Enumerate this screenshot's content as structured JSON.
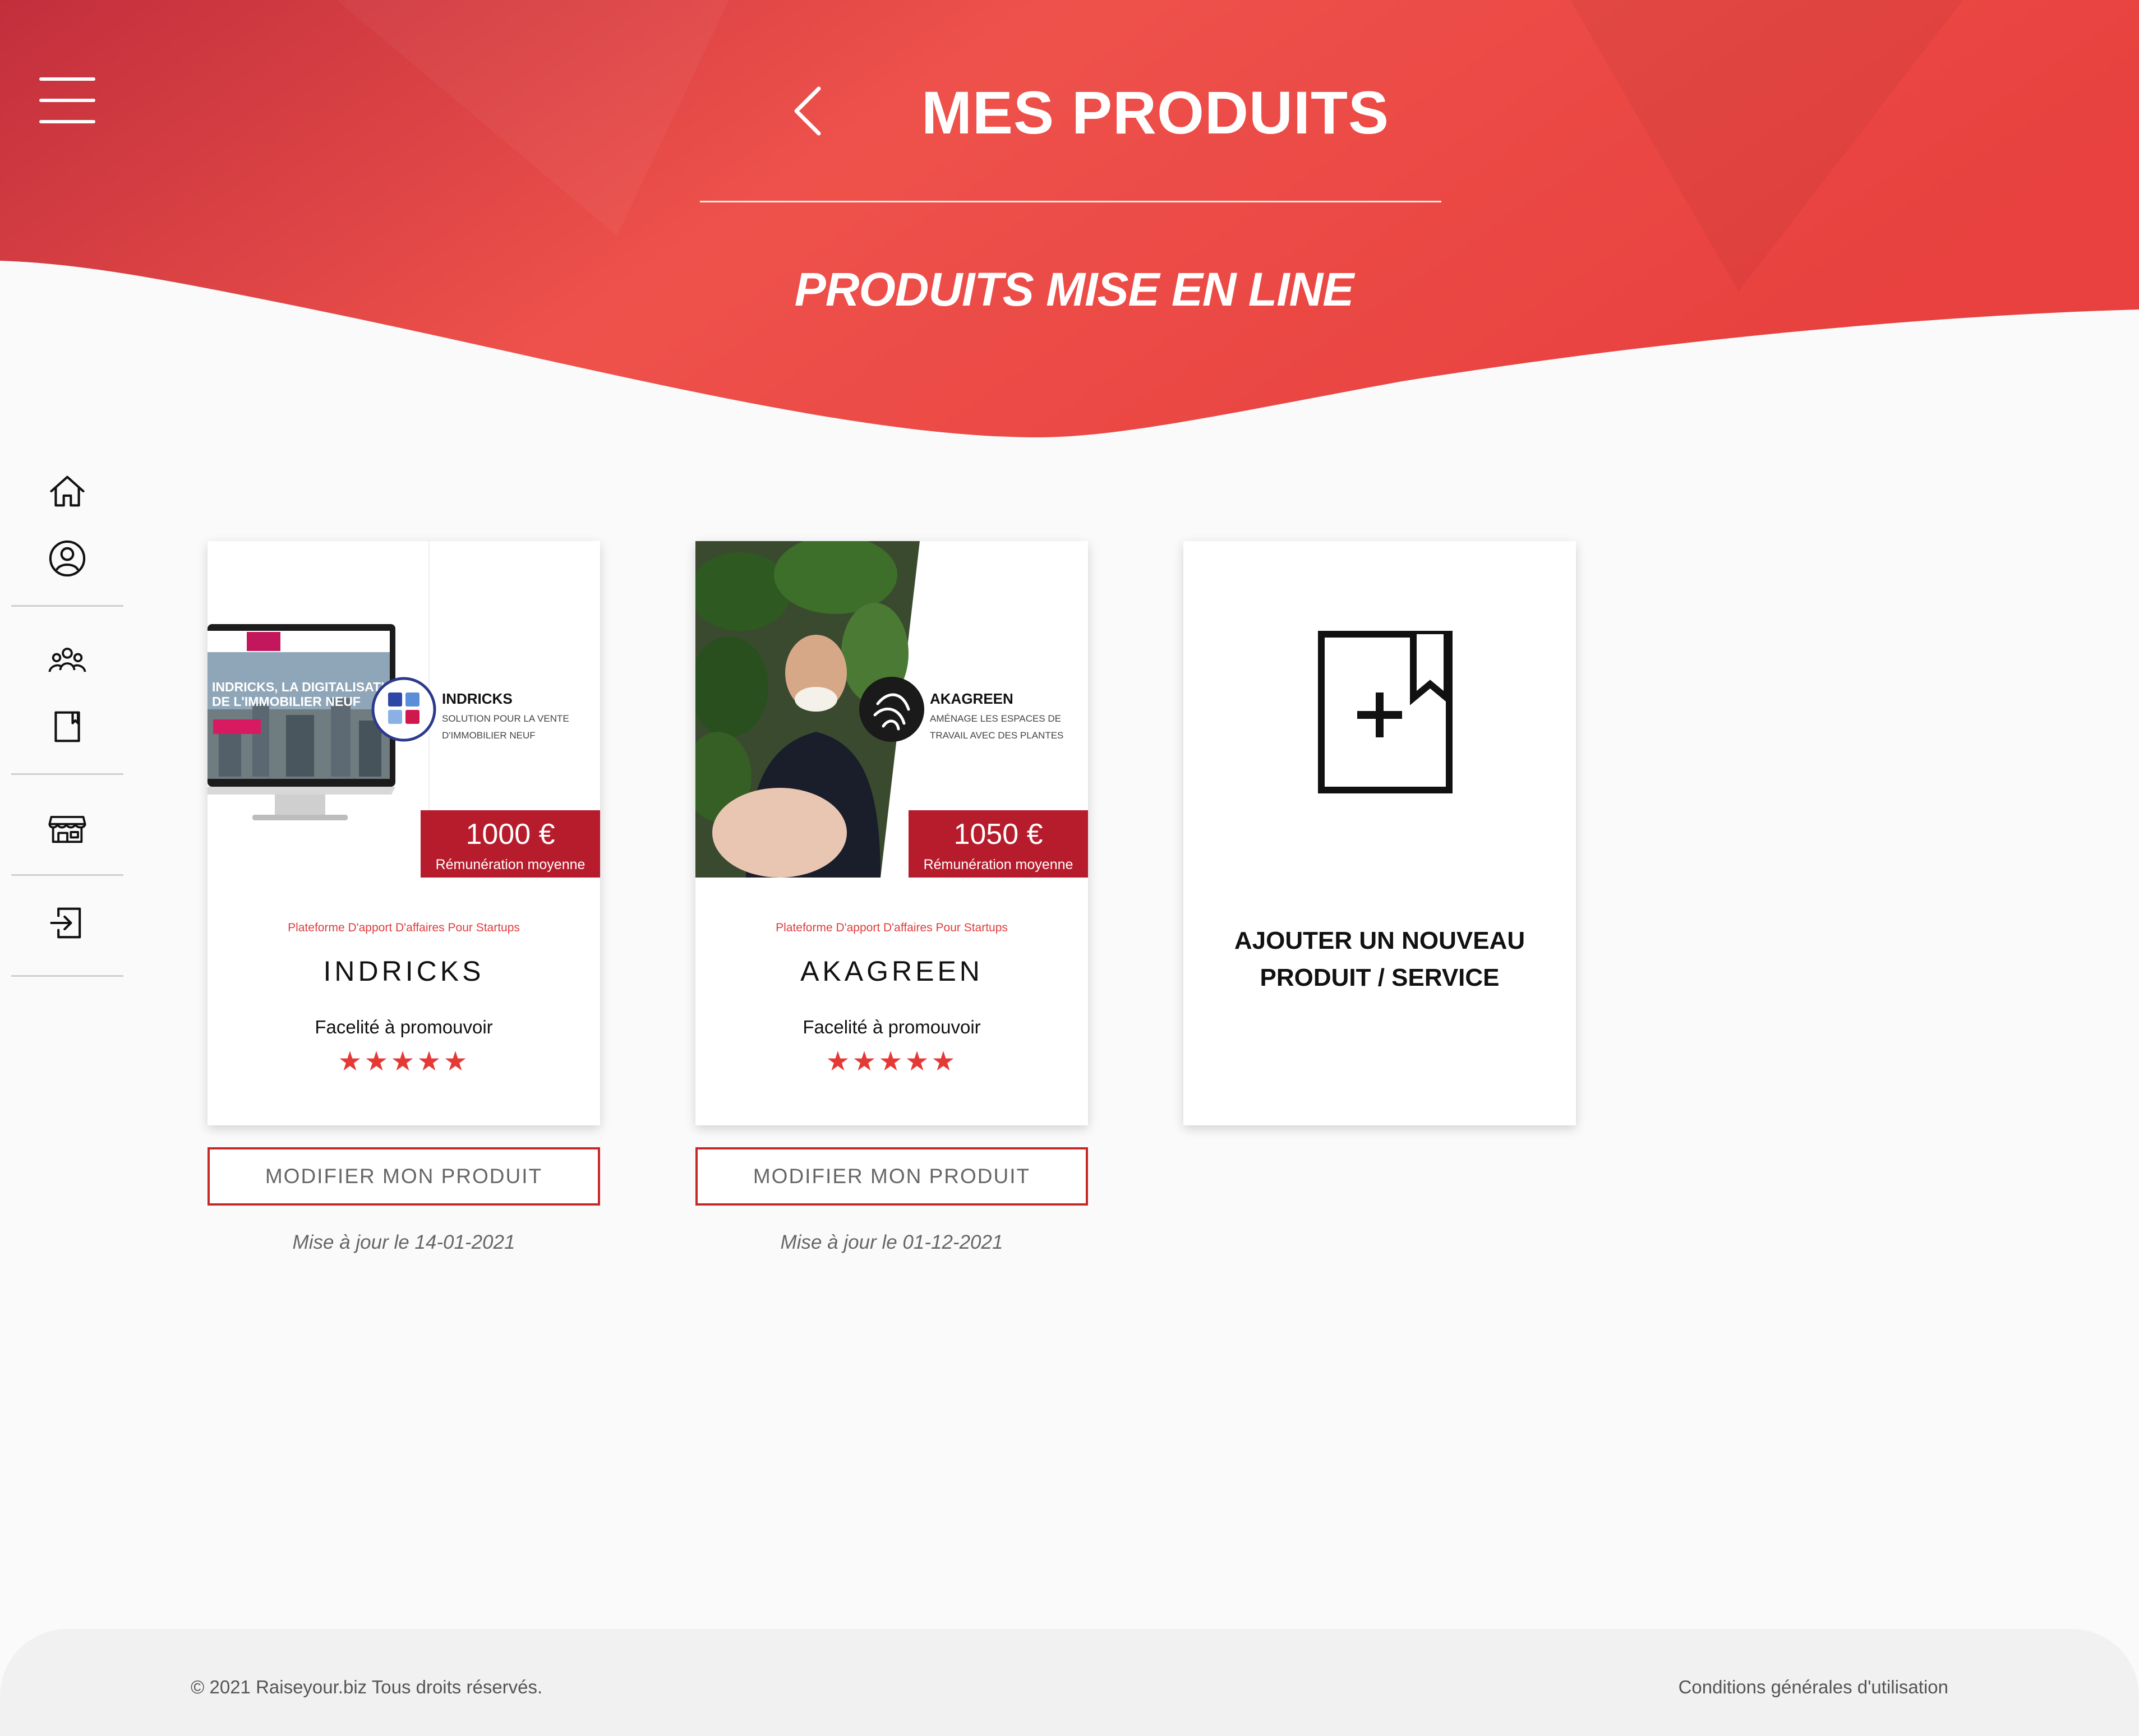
{
  "header": {
    "title": "MES PRODUITS",
    "subtitle": "PRODUITS MISE EN LINE",
    "gradient_start": "#c7303c",
    "gradient_end": "#ef524a"
  },
  "sidebar": {
    "items": [
      {
        "icon": "home-icon"
      },
      {
        "icon": "user-circle-icon"
      },
      {
        "icon": "users-group-icon"
      },
      {
        "icon": "document-icon"
      },
      {
        "icon": "store-icon"
      },
      {
        "icon": "logout-icon"
      }
    ]
  },
  "products": [
    {
      "category": "Plateforme D'apport D'affaires Pour Startups",
      "name": "INDRICKS",
      "ease": "Facelité à promouvoir",
      "stars": "★★★★★",
      "price": "1000 €",
      "price_caption": "Rémunération moyenne",
      "brand": "INDRICKS",
      "brand_tagline_1": "SOLUTION POUR LA VENTE",
      "brand_tagline_2": "D'IMMOBILIER NEUF",
      "screen_headline_1": "INDRICKS, LA DIGITALISATION",
      "screen_headline_2": "DE L'IMMOBILIER NEUF",
      "edit_label": "MODIFIER MON PRODUIT",
      "updated": "Mise à jour le 14-01-2021"
    },
    {
      "category": "Plateforme D'apport D'affaires Pour Startups",
      "name": "AKAGREEN",
      "ease": "Facelité à promouvoir",
      "stars": "★★★★★",
      "price": "1050 €",
      "price_caption": "Rémunération moyenne",
      "brand": "AKAGREEN",
      "brand_tagline_1": "AMÉNAGE LES ESPACES DE",
      "brand_tagline_2": "TRAVAIL AVEC DES PLANTES",
      "edit_label": "MODIFIER MON PRODUIT",
      "updated": "Mise à jour le 01-12-2021"
    }
  ],
  "add_card": {
    "line1": "AJOUTER UN NOUVEAU",
    "line2": "PRODUIT / SERVICE"
  },
  "footer": {
    "copyright": "© 2021 Raiseyour.biz Tous droits réservés.",
    "terms": "Conditions générales d'utilisation"
  },
  "colors": {
    "accent": "#e53935",
    "price_badge": "#b71c2c",
    "button_border": "#c62828"
  }
}
